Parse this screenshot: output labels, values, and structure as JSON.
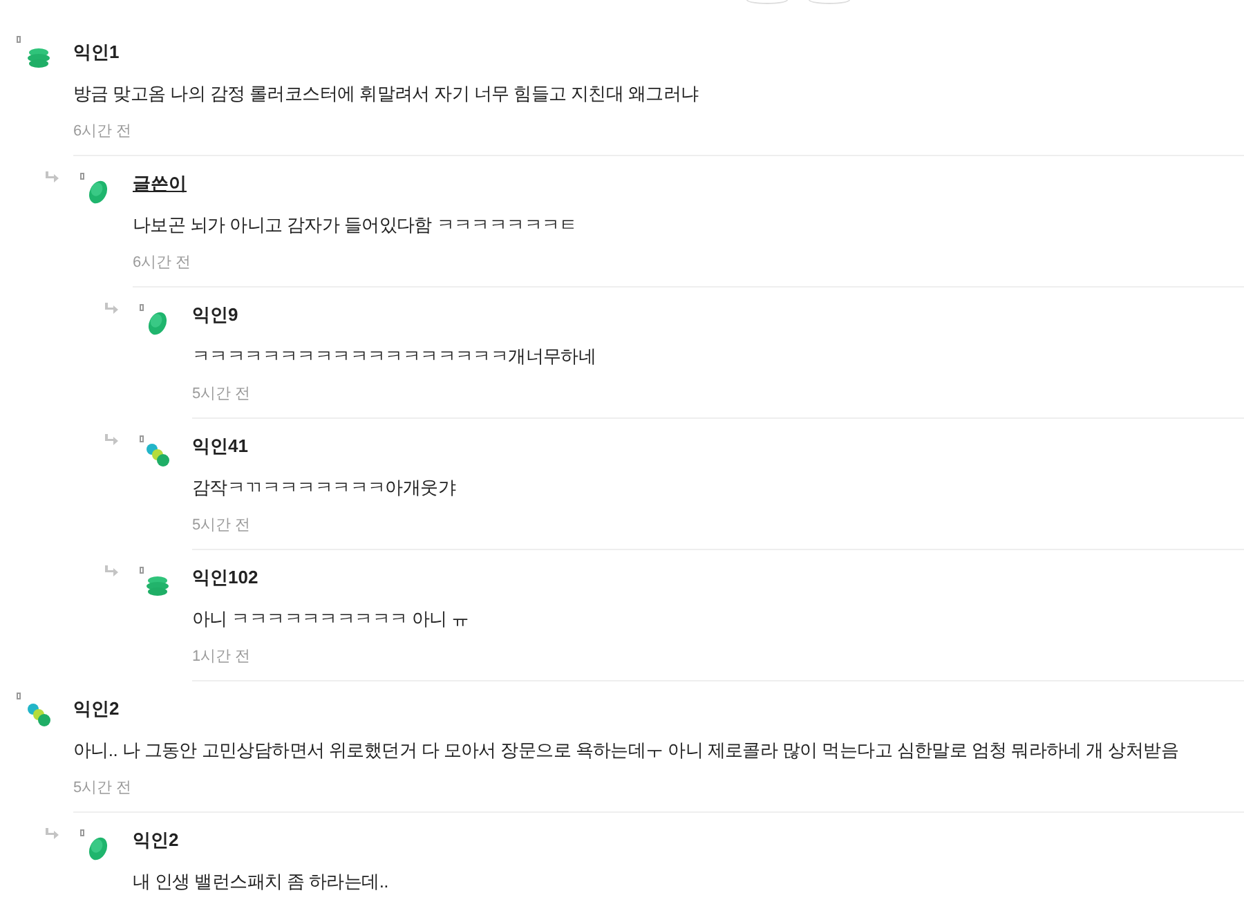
{
  "comments": [
    {
      "author": "익인1",
      "is_author": false,
      "kind": "stack",
      "text": "방금 맞고옴 나의 감정 롤러코스터에 휘말려서 자기 너무 힘들고 지친대 왜그러냐",
      "time": "6시간 전",
      "children": [
        {
          "author": "글쓴이",
          "is_author": true,
          "kind": "oval",
          "text": "나보곤 뇌가 아니고 감자가 들어있다함 ㅋㅋㅋㅋㅋㅋㅋㅌ",
          "time": "6시간 전",
          "children": [
            {
              "author": "익인9",
              "is_author": false,
              "kind": "oval",
              "text": "ㅋㅋㅋㅋㅋㅋㅋㅋㅋㅋㅋㅋㅋㅋㅋㅋㅋㅋ개너무하네",
              "time": "5시간 전"
            },
            {
              "author": "익인41",
              "is_author": false,
              "kind": "dots",
              "text": "감작ㅋㄲㅋㅋㅋㅋㅋㅋㅋ아개웃갸",
              "time": "5시간 전"
            },
            {
              "author": "익인102",
              "is_author": false,
              "kind": "stack",
              "text": "아니 ㅋㅋㅋㅋㅋㅋㅋㅋㅋㅋ 아니 ㅠ",
              "time": "1시간 전"
            }
          ]
        }
      ]
    },
    {
      "author": "익인2",
      "is_author": false,
      "kind": "dots",
      "text": "아니.. 나 그동안 고민상담하면서 위로했던거 다 모아서 장문으로 욕하는데ㅜ 아니 제로콜라 많이 먹는다고 심한말로 엄청 뭐라하네 개 상처받음",
      "time": "5시간 전",
      "children": [
        {
          "author": "익인2",
          "is_author": false,
          "kind": "oval",
          "text": "내 인생 밸런스패치 좀 하라는데.."
        }
      ]
    }
  ]
}
